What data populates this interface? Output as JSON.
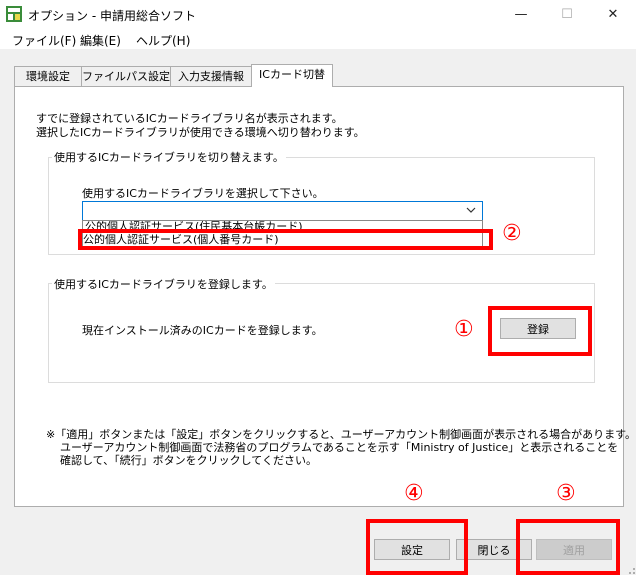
{
  "window": {
    "title": "オプション - 申請用総合ソフト",
    "minimize_glyph": "—",
    "maximize_glyph": "☐",
    "close_glyph": "✕"
  },
  "menu": {
    "items": [
      {
        "label": "ファイル(F)"
      },
      {
        "label": "編集(E)"
      },
      {
        "label": "ヘルプ(H)"
      }
    ]
  },
  "tabs": [
    {
      "label": "環境設定",
      "active": false
    },
    {
      "label": "ファイルパス設定",
      "active": false
    },
    {
      "label": "入力支援情報",
      "active": false
    },
    {
      "label": "ICカード切替",
      "active": true
    }
  ],
  "description": {
    "line1": "すでに登録されているICカードライブラリ名が表示されます。",
    "line2": "選択したICカードライブラリが使用できる環境へ切り替わります。"
  },
  "switch_group": {
    "title": "使用するICカードライブラリを切り替えます。",
    "select_label": "使用するICカードライブラリを選択して下さい。",
    "selected_value": "",
    "options": [
      "公的個人認証サービス(住民基本台帳カード)",
      "公的個人認証サービス(個人番号カード)"
    ]
  },
  "register_group": {
    "title": "使用するICカードライブラリを登録します。",
    "text": "現在インストール済みのICカードを登録します。",
    "button_label": "登録"
  },
  "note": {
    "line1": "※「適用」ボタンまたは「設定」ボタンをクリックすると、ユーザーアカウント制御画面が表示される場合があります。",
    "line2": "ユーザーアカウント制御画面で法務省のプログラムであることを示す「Ministry of Justice」と表示されることを",
    "line3": "確認して、「続行」ボタンをクリックしてください。"
  },
  "footer": {
    "settings_label": "設定",
    "close_label": "閉じる",
    "apply_label": "適用"
  },
  "annotations": {
    "m1": "①",
    "m2": "②",
    "m3": "③",
    "m4": "④"
  },
  "colors": {
    "highlight_red": "#ff0000",
    "focus_blue": "#0078d7"
  }
}
